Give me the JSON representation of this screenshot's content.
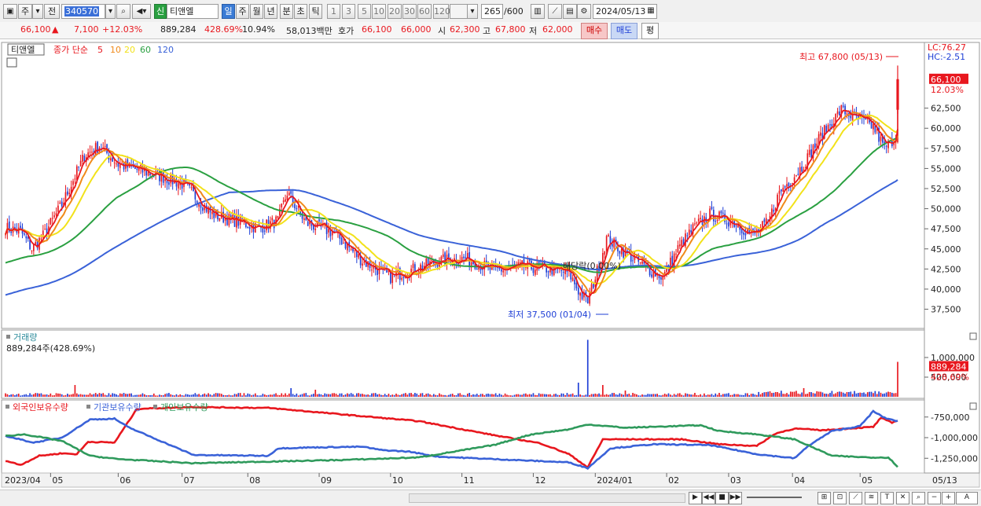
{
  "toolbar": {
    "tab_week": "주",
    "tab_prev": "전",
    "code": "340570",
    "badge": "신",
    "name": "티앤엘",
    "periods": [
      "일",
      "주",
      "월",
      "년",
      "분",
      "초",
      "틱"
    ],
    "numbers": [
      "1",
      "3",
      "5",
      "10",
      "20",
      "30",
      "60",
      "120"
    ],
    "count": "265",
    "total": "/600",
    "date": "2024/05/13"
  },
  "quote": {
    "price": "66,100",
    "arrow": "▲",
    "change": "7,100",
    "pct": "+12.03%",
    "volume": "889,284",
    "vol_ratio": "428.69%",
    "turnover": "10.94%",
    "amount": "58,013백만",
    "ask_label": "호가",
    "ask1": "66,100",
    "ask2": "66,000",
    "open_label": "시",
    "open": "62,300",
    "high_label": "고",
    "high": "67,800",
    "low_label": "저",
    "low": "62,000",
    "buy": "매수",
    "sell": "매도",
    "even": "평"
  },
  "colors": {
    "up": "#e8171e",
    "down": "#1f3fd6",
    "ma5": "#e8171e",
    "ma10": "#f08a1a",
    "ma20": "#f2e21a",
    "ma60": "#2aa041",
    "ma120": "#3a62d8",
    "foreign": "#e8171e",
    "inst": "#3a62d8",
    "indiv": "#2f9a5c"
  },
  "chart_data": [
    {
      "type": "candlestick",
      "legend_stock": "티앤엘",
      "legend_ma_label": "종가 단순",
      "ma_periods": [
        "5",
        "10",
        "20",
        "60",
        "120"
      ],
      "ylim": [
        35500,
        69500
      ],
      "y_ticks": [
        37500,
        40000,
        42500,
        45000,
        47500,
        50000,
        52500,
        55000,
        57500,
        60000,
        62500
      ],
      "y_tick_labels": [
        "37,500",
        "40,000",
        "42,500",
        "45,000",
        "47,500",
        "50,000",
        "52,500",
        "55,000",
        "57,500",
        "60,000",
        "62,500"
      ],
      "months": [
        "2023/04",
        "05",
        "06",
        "07",
        "08",
        "09",
        "10",
        "11",
        "12",
        "2024/01",
        "02",
        "03",
        "04",
        "05",
        "05/13"
      ],
      "close_keypoints": [
        [
          0,
          47600
        ],
        [
          8,
          47200
        ],
        [
          14,
          45000
        ],
        [
          20,
          46600
        ],
        [
          30,
          50500
        ],
        [
          42,
          56600
        ],
        [
          50,
          57800
        ],
        [
          60,
          55500
        ],
        [
          80,
          54200
        ],
        [
          95,
          53000
        ],
        [
          110,
          49300
        ],
        [
          125,
          48300
        ],
        [
          135,
          47600
        ],
        [
          145,
          48500
        ],
        [
          150,
          52000
        ],
        [
          160,
          48200
        ],
        [
          175,
          47000
        ],
        [
          190,
          43500
        ],
        [
          205,
          41500
        ],
        [
          215,
          42300
        ],
        [
          230,
          43500
        ],
        [
          245,
          43800
        ],
        [
          260,
          42300
        ],
        [
          275,
          42800
        ],
        [
          290,
          42500
        ],
        [
          300,
          42000
        ],
        [
          306,
          39400
        ],
        [
          310,
          38500
        ],
        [
          316,
          43000
        ],
        [
          320,
          46300
        ],
        [
          330,
          44500
        ],
        [
          342,
          42500
        ],
        [
          350,
          41500
        ],
        [
          358,
          45000
        ],
        [
          366,
          47500
        ],
        [
          375,
          49300
        ],
        [
          388,
          48300
        ],
        [
          398,
          46700
        ],
        [
          406,
          48300
        ],
        [
          412,
          52000
        ],
        [
          424,
          55200
        ],
        [
          434,
          59000
        ],
        [
          445,
          62300
        ],
        [
          455,
          61000
        ],
        [
          462,
          60200
        ],
        [
          468,
          57500
        ],
        [
          474,
          59000
        ],
        [
          475,
          66100
        ]
      ],
      "ma_start": {
        "ma60": 43200,
        "ma120": 39200
      },
      "high_annotation": {
        "text": "최고 67,800 (05/13)",
        "value": 67800
      },
      "low_annotation": {
        "text": "최저 37,500 (01/04)",
        "value": 37500
      },
      "event_annotation": "배당락(0.00%)",
      "lc": "LC:76.27",
      "hc": "HC:-2.51",
      "last_price": "66,100",
      "last_pct": "12.03%"
    },
    {
      "type": "bar",
      "title": "거래량",
      "subtitle": "889,284주(428.69%)",
      "ylim": [
        0,
        1500000
      ],
      "y_ticks": [
        500000,
        1000000
      ],
      "y_tick_labels": [
        "500,000",
        "1,000,000"
      ],
      "last_value": 889284,
      "last_label": "889,284",
      "last_pct": "428.69%",
      "spikes": [
        [
          37,
          300000
        ],
        [
          152,
          220000
        ],
        [
          165,
          180000
        ],
        [
          310,
          1450000
        ],
        [
          305,
          360000
        ],
        [
          318,
          300000
        ],
        [
          330,
          160000
        ],
        [
          425,
          220000
        ],
        [
          440,
          150000
        ],
        [
          470,
          130000
        ],
        [
          475,
          889284
        ]
      ]
    },
    {
      "type": "line",
      "series": [
        {
          "name": "외국인보유수량",
          "keypoints": [
            [
              0,
              -1280000
            ],
            [
              8,
              -1330000
            ],
            [
              18,
              -1220000
            ],
            [
              30,
              -1190000
            ],
            [
              38,
              -1200000
            ],
            [
              44,
              -1050000
            ],
            [
              58,
              -1060000
            ],
            [
              70,
              -650000
            ],
            [
              100,
              -630000
            ],
            [
              140,
              -640000
            ],
            [
              180,
              -720000
            ],
            [
              220,
              -800000
            ],
            [
              260,
              -970000
            ],
            [
              285,
              -1070000
            ],
            [
              300,
              -1200000
            ],
            [
              310,
              -1360000
            ],
            [
              318,
              -1020000
            ],
            [
              360,
              -1020000
            ],
            [
              380,
              -1080000
            ],
            [
              400,
              -1100000
            ],
            [
              410,
              -950000
            ],
            [
              420,
              -890000
            ],
            [
              435,
              -910000
            ],
            [
              455,
              -880000
            ],
            [
              462,
              -870000
            ],
            [
              466,
              -760000
            ],
            [
              472,
              -820000
            ],
            [
              475,
              -790000
            ]
          ]
        },
        {
          "name": "기관보유수량",
          "keypoints": [
            [
              0,
              -980000
            ],
            [
              15,
              -1060000
            ],
            [
              30,
              -1000000
            ],
            [
              45,
              -780000
            ],
            [
              58,
              -770000
            ],
            [
              65,
              -870000
            ],
            [
              100,
              -1210000
            ],
            [
              140,
              -1220000
            ],
            [
              145,
              -1130000
            ],
            [
              160,
              -1120000
            ],
            [
              190,
              -1110000
            ],
            [
              200,
              -1150000
            ],
            [
              215,
              -1170000
            ],
            [
              230,
              -1230000
            ],
            [
              260,
              -1260000
            ],
            [
              300,
              -1300000
            ],
            [
              310,
              -1370000
            ],
            [
              322,
              -1130000
            ],
            [
              345,
              -1080000
            ],
            [
              375,
              -1090000
            ],
            [
              400,
              -1200000
            ],
            [
              420,
              -1250000
            ],
            [
              428,
              -1090000
            ],
            [
              440,
              -920000
            ],
            [
              455,
              -860000
            ],
            [
              462,
              -680000
            ],
            [
              468,
              -760000
            ],
            [
              475,
              -800000
            ]
          ]
        },
        {
          "name": "개인보유수량",
          "keypoints": [
            [
              0,
              -980000
            ],
            [
              10,
              -960000
            ],
            [
              20,
              -1000000
            ],
            [
              30,
              -1040000
            ],
            [
              45,
              -1220000
            ],
            [
              60,
              -1260000
            ],
            [
              100,
              -1310000
            ],
            [
              140,
              -1290000
            ],
            [
              180,
              -1270000
            ],
            [
              220,
              -1240000
            ],
            [
              260,
              -1090000
            ],
            [
              280,
              -960000
            ],
            [
              300,
              -900000
            ],
            [
              310,
              -840000
            ],
            [
              330,
              -880000
            ],
            [
              370,
              -850000
            ],
            [
              380,
              -920000
            ],
            [
              400,
              -960000
            ],
            [
              420,
              -1020000
            ],
            [
              440,
              -1220000
            ],
            [
              460,
              -1240000
            ],
            [
              470,
              -1240000
            ],
            [
              475,
              -1350000
            ]
          ]
        }
      ],
      "ylim": [
        -1400000,
        -600000
      ],
      "y_ticks": [
        -750000,
        -1000000,
        -1250000
      ],
      "y_tick_labels": [
        "-750,000",
        "-1,000,000",
        "-1,250,000"
      ]
    }
  ]
}
